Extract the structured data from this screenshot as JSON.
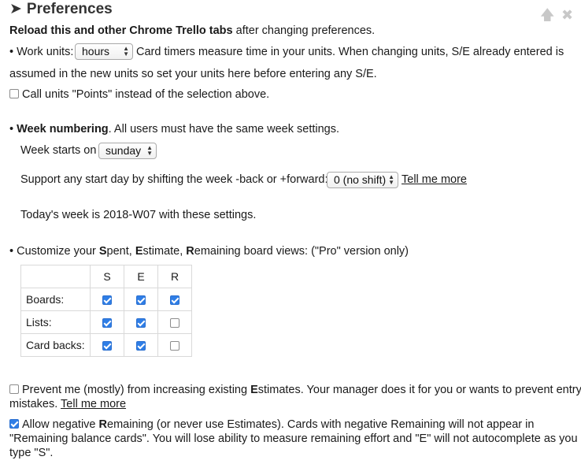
{
  "title": "Preferences",
  "title_arrow": "➤",
  "icons": {
    "up": "up-arrow-icon",
    "close": "close-icon"
  },
  "reload_note": {
    "bold": "Reload this and other Chrome Trello tabs",
    "rest": "after changing preferences."
  },
  "work_units": {
    "bullet_label": "• Work units:",
    "selected": "hours",
    "desc_line1": "Card timers measure time in your units. When changing units, S/E already entered is",
    "desc_line2": "assumed in the new units so set your units here before entering any S/E."
  },
  "points_option": {
    "checked": false,
    "label": "Call units \"Points\" instead of the selection above."
  },
  "week": {
    "bullet": "•",
    "heading": "Week numbering",
    "heading_rest": ". All users must have the same week settings.",
    "starts_label": "Week starts on",
    "starts_selected": "sunday",
    "shift_label": "Support any start day by shifting the week -back or +forward:",
    "shift_selected": "0 (no shift)",
    "tell_more": "Tell me more",
    "today_text": "Today's week is 2018-W07 with these settings."
  },
  "views": {
    "intro_prefix": "• Customize your ",
    "intro_parts": [
      "S",
      "pent, ",
      "E",
      "stimate, ",
      "R",
      "emaining board views: (\"Pro\" version only)"
    ],
    "columns": [
      "S",
      "E",
      "R"
    ],
    "rows": [
      {
        "label": "Boards:",
        "checks": [
          true,
          true,
          true
        ]
      },
      {
        "label": "Lists:",
        "checks": [
          true,
          true,
          false
        ]
      },
      {
        "label": "Card backs:",
        "checks": [
          true,
          true,
          false
        ]
      }
    ]
  },
  "prevent_option": {
    "checked": false,
    "pre": "Prevent me (mostly) from increasing existing ",
    "bold": "E",
    "post": "stimates. Your manager does it for you or wants to prevent entry",
    "line2": "mistakes.",
    "tell_more": "Tell me more"
  },
  "negative_option": {
    "checked": true,
    "pre": "Allow negative ",
    "bold": "R",
    "post": "emaining (or never use Estimates). Cards with negative Remaining will not appear in",
    "line2": "\"Remaining balance cards\". You will lose ability to measure remaining effort and \"E\" will not autocomplete as you",
    "line3": "type \"S\"."
  }
}
